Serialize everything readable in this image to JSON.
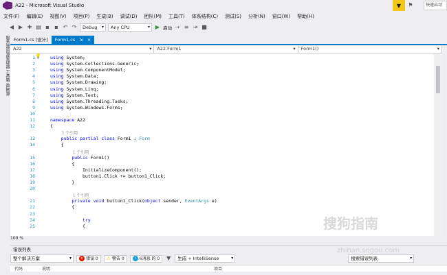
{
  "window": {
    "title": "A22 - Microsoft Visual Studio",
    "quick_launch": "快速启动"
  },
  "menu": [
    "文件(F)",
    "编辑(E)",
    "视图(V)",
    "项目(P)",
    "生成(B)",
    "调试(D)",
    "团队(M)",
    "工具(T)",
    "体系结构(C)",
    "测试(S)",
    "分析(N)",
    "窗口(W)",
    "帮助(H)"
  ],
  "toolbar": {
    "config": "Debug",
    "platform": "Any CPU",
    "start": "启动"
  },
  "sidebar": {
    "label": "服务器资源管理器  工具箱  数据源"
  },
  "tabs": [
    {
      "label": "Form1.cs [设计]"
    },
    {
      "label": "Form1.cs",
      "active": true
    }
  ],
  "nav": {
    "project": "A22",
    "class": "A22.Form1",
    "member": "Form1()"
  },
  "code": [
    {
      "n": "1",
      "t": "using System;"
    },
    {
      "n": "2",
      "t": "using System.Collections.Generic;"
    },
    {
      "n": "3",
      "t": "using System.ComponentModel;"
    },
    {
      "n": "4",
      "t": "using System.Data;"
    },
    {
      "n": "5",
      "t": "using System.Drawing;"
    },
    {
      "n": "6",
      "t": "using System.Linq;"
    },
    {
      "n": "7",
      "t": "using System.Text;"
    },
    {
      "n": "8",
      "t": "using System.Threading.Tasks;"
    },
    {
      "n": "9",
      "t": "using System.Windows.Forms;"
    },
    {
      "n": "10",
      "t": ""
    },
    {
      "n": "11",
      "t": "namespace A22"
    },
    {
      "n": "12",
      "t": "{"
    },
    {
      "n": "13",
      "t": "    public partial class Form1 : Form",
      "lens": "3 个引用"
    },
    {
      "n": "14",
      "t": "    {"
    },
    {
      "n": "15",
      "t": "        public Form1()",
      "lens": "1 个引用"
    },
    {
      "n": "16",
      "t": "        {"
    },
    {
      "n": "17",
      "t": "            InitializeComponent();"
    },
    {
      "n": "18",
      "t": "            button1.Click += button1_Click;"
    },
    {
      "n": "19",
      "t": "        }"
    },
    {
      "n": "20",
      "t": ""
    },
    {
      "n": "21",
      "t": "        private void button1_Click(object sender, EventArgs e)",
      "lens": "1 个引用"
    },
    {
      "n": "22",
      "t": "        {"
    },
    {
      "n": "23",
      "t": ""
    },
    {
      "n": "24",
      "t": "            try"
    },
    {
      "n": "25",
      "t": "            {"
    }
  ],
  "zoom": "100 %",
  "error_list": {
    "title": "错误列表",
    "scope": "整个解决方案",
    "errors": "错误 0",
    "warnings": "警告 0",
    "messages": "6消息 的 0",
    "build": "生成 + IntelliSense",
    "search": "搜索错误列表",
    "columns": [
      "代码",
      "说明",
      "项目"
    ]
  },
  "watermark": {
    "brand": "搜狗指南",
    "url": "zhinan.sogou.com"
  }
}
